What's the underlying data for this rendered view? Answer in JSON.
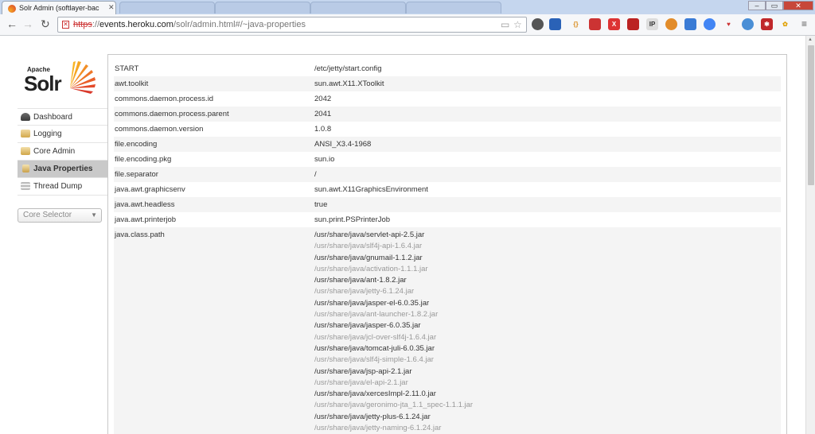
{
  "browser": {
    "tab_title": "Solr Admin (softlayer-bac",
    "url_protocol": "https",
    "url_host": "events.heroku.com",
    "url_path": "/solr/admin.html#/~java-properties"
  },
  "logo": {
    "apache": "Apache",
    "solr": "Solr"
  },
  "sidebar": {
    "items": [
      {
        "label": "Dashboard",
        "icon": "dashboard-icon"
      },
      {
        "label": "Logging",
        "icon": "logging-icon"
      },
      {
        "label": "Core Admin",
        "icon": "core-admin-icon"
      },
      {
        "label": "Java Properties",
        "icon": "java-icon",
        "active": true
      },
      {
        "label": "Thread Dump",
        "icon": "thread-dump-icon"
      }
    ],
    "core_selector": "Core Selector"
  },
  "properties": [
    {
      "key": "START",
      "value": "/etc/jetty/start.config"
    },
    {
      "key": "awt.toolkit",
      "value": "sun.awt.X11.XToolkit"
    },
    {
      "key": "commons.daemon.process.id",
      "value": "2042"
    },
    {
      "key": "commons.daemon.process.parent",
      "value": "2041"
    },
    {
      "key": "commons.daemon.version",
      "value": "1.0.8"
    },
    {
      "key": "file.encoding",
      "value": "ANSI_X3.4-1968"
    },
    {
      "key": "file.encoding.pkg",
      "value": "sun.io"
    },
    {
      "key": "file.separator",
      "value": "/"
    },
    {
      "key": "java.awt.graphicsenv",
      "value": "sun.awt.X11GraphicsEnvironment"
    },
    {
      "key": "java.awt.headless",
      "value": "true"
    },
    {
      "key": "java.awt.printerjob",
      "value": "sun.print.PSPrinterJob"
    }
  ],
  "classpath": {
    "key": "java.class.path",
    "values": [
      "/usr/share/java/servlet-api-2.5.jar",
      "/usr/share/java/slf4j-api-1.6.4.jar",
      "/usr/share/java/gnumail-1.1.2.jar",
      "/usr/share/java/activation-1.1.1.jar",
      "/usr/share/java/ant-1.8.2.jar",
      "/usr/share/java/jetty-6.1.24.jar",
      "/usr/share/java/jasper-el-6.0.35.jar",
      "/usr/share/java/ant-launcher-1.8.2.jar",
      "/usr/share/java/jasper-6.0.35.jar",
      "/usr/share/java/jcl-over-slf4j-1.6.4.jar",
      "/usr/share/java/tomcat-juli-6.0.35.jar",
      "/usr/share/java/slf4j-simple-1.6.4.jar",
      "/usr/share/java/jsp-api-2.1.jar",
      "/usr/share/java/el-api-2.1.jar",
      "/usr/share/java/xercesImpl-2.11.0.jar",
      "/usr/share/java/geronimo-jta_1.1_spec-1.1.1.jar",
      "/usr/share/java/jetty-plus-6.1.24.jar",
      "/usr/share/java/jetty-naming-6.1.24.jar"
    ]
  },
  "colors": {
    "active_nav": "#c9c9c9",
    "row_alt": "#f4f4f4",
    "muted_text": "#999999"
  }
}
